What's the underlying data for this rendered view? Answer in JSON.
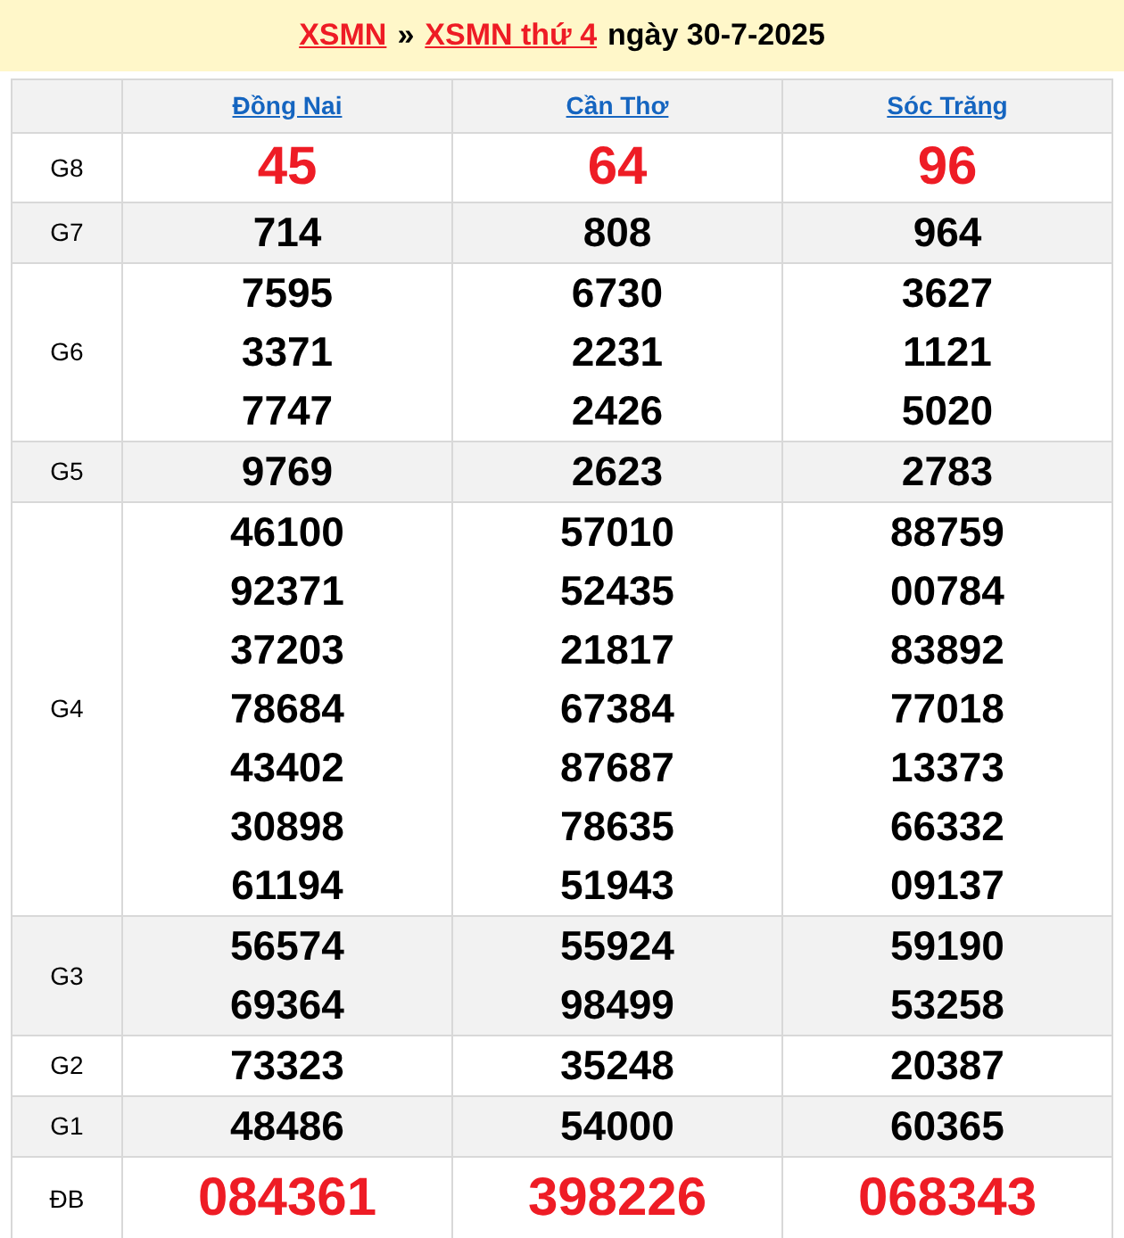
{
  "title": {
    "home_link": "XSMN",
    "separator": "»",
    "day_link": "XSMN thứ 4",
    "date": "ngày 30-7-2025"
  },
  "provinces": [
    "Đồng Nai",
    "Cần Thơ",
    "Sóc Trăng"
  ],
  "prizes": [
    {
      "label": "G8",
      "kind": "highlight",
      "results": [
        [
          "45"
        ],
        [
          "64"
        ],
        [
          "96"
        ]
      ]
    },
    {
      "label": "G7",
      "kind": "normal",
      "results": [
        [
          "714"
        ],
        [
          "808"
        ],
        [
          "964"
        ]
      ]
    },
    {
      "label": "G6",
      "kind": "normal",
      "results": [
        [
          "7595",
          "3371",
          "7747"
        ],
        [
          "6730",
          "2231",
          "2426"
        ],
        [
          "3627",
          "1121",
          "5020"
        ]
      ]
    },
    {
      "label": "G5",
      "kind": "normal",
      "results": [
        [
          "9769"
        ],
        [
          "2623"
        ],
        [
          "2783"
        ]
      ]
    },
    {
      "label": "G4",
      "kind": "normal",
      "results": [
        [
          "46100",
          "92371",
          "37203",
          "78684",
          "43402",
          "30898",
          "61194"
        ],
        [
          "57010",
          "52435",
          "21817",
          "67384",
          "87687",
          "78635",
          "51943"
        ],
        [
          "88759",
          "00784",
          "83892",
          "77018",
          "13373",
          "66332",
          "09137"
        ]
      ]
    },
    {
      "label": "G3",
      "kind": "normal",
      "results": [
        [
          "56574",
          "69364"
        ],
        [
          "55924",
          "98499"
        ],
        [
          "59190",
          "53258"
        ]
      ]
    },
    {
      "label": "G2",
      "kind": "normal",
      "results": [
        [
          "73323"
        ],
        [
          "35248"
        ],
        [
          "20387"
        ]
      ]
    },
    {
      "label": "G1",
      "kind": "normal",
      "results": [
        [
          "48486"
        ],
        [
          "54000"
        ],
        [
          "60365"
        ]
      ]
    },
    {
      "label": "ĐB",
      "kind": "jackpot",
      "results": [
        [
          "084361"
        ],
        [
          "398226"
        ],
        [
          "068343"
        ]
      ]
    }
  ]
}
